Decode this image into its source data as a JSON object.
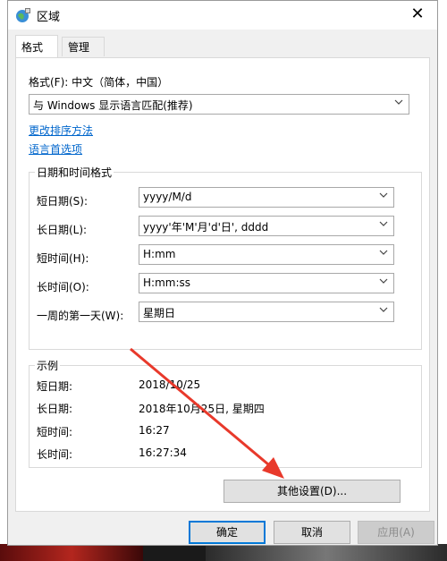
{
  "window": {
    "title": "区域",
    "close_glyph": "✕"
  },
  "tabs": [
    {
      "label": "格式",
      "active": true
    },
    {
      "label": "管理",
      "active": false
    }
  ],
  "format": {
    "label": "格式(F): 中文（简体，中国）",
    "selected": "与 Windows 显示语言匹配(推荐)"
  },
  "links": {
    "sort": "更改排序方法",
    "language": "语言首选项"
  },
  "datetime": {
    "title": "日期和时间格式",
    "rows": [
      {
        "label": "短日期(S):",
        "value": "yyyy/M/d"
      },
      {
        "label": "长日期(L):",
        "value": "yyyy'年'M'月'd'日', dddd"
      },
      {
        "label": "短时间(H):",
        "value": "H:mm"
      },
      {
        "label": "长时间(O):",
        "value": "H:mm:ss"
      },
      {
        "label": "一周的第一天(W):",
        "value": "星期日"
      }
    ]
  },
  "examples": {
    "title": "示例",
    "rows": [
      {
        "label": "短日期:",
        "value": "2018/10/25"
      },
      {
        "label": "长日期:",
        "value": "2018年10月25日, 星期四"
      },
      {
        "label": "短时间:",
        "value": "16:27"
      },
      {
        "label": "长时间:",
        "value": "16:27:34"
      }
    ]
  },
  "buttons": {
    "other_settings": "其他设置(D)...",
    "ok": "确定",
    "cancel": "取消",
    "apply": "应用(A)"
  },
  "colors": {
    "link": "#0066cc",
    "accent": "#0078d7",
    "arrow": "#e8392b"
  }
}
